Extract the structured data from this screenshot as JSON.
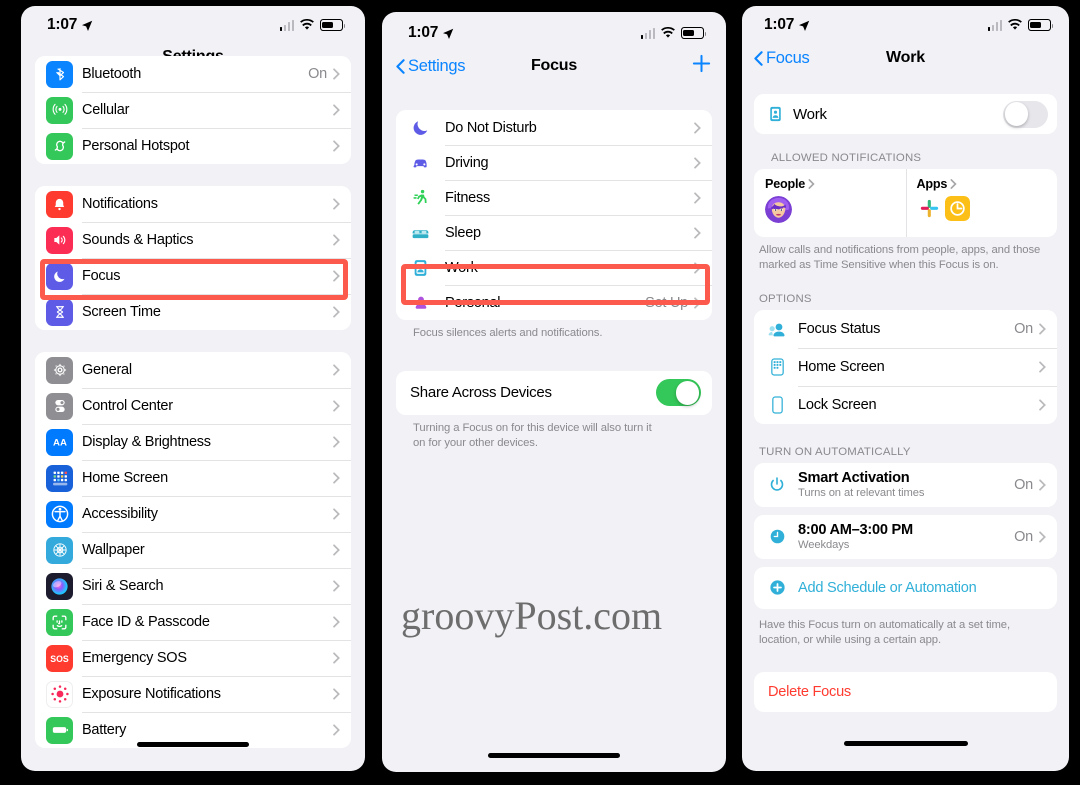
{
  "statusbar": {
    "time": "1:07",
    "location_icon": "location-arrow-icon",
    "cellular_icon": "cellular-signal-icon",
    "wifi_icon": "wifi-icon",
    "battery_icon": "battery-icon"
  },
  "watermark": {
    "text": "groovyPost.com"
  },
  "colors": {
    "accent_blue": "#0a84ff",
    "teal": "#30b0d8",
    "green": "#34c759",
    "red": "#ff3b30",
    "highlight": "#fc5a4d",
    "indigo": "#5856d6"
  },
  "panel_settings": {
    "nav": {
      "title": "Settings"
    },
    "group1": [
      {
        "label": "Bluetooth",
        "value": "On",
        "icon": "bluetooth-icon",
        "color": "#0a84ff"
      },
      {
        "label": "Cellular",
        "value": "",
        "icon": "cellular-icon",
        "color": "#34c759"
      },
      {
        "label": "Personal Hotspot",
        "value": "",
        "icon": "hotspot-icon",
        "color": "#34c759"
      }
    ],
    "group2": [
      {
        "label": "Notifications",
        "value": "",
        "icon": "notifications-bell-icon",
        "color": "#ff3b30"
      },
      {
        "label": "Sounds & Haptics",
        "value": "",
        "icon": "sounds-speaker-icon",
        "color": "#fc2d55"
      },
      {
        "label": "Focus",
        "value": "",
        "icon": "focus-moon-icon",
        "color": "#5e5ce6"
      },
      {
        "label": "Screen Time",
        "value": "",
        "icon": "screen-time-hourglass-icon",
        "color": "#5e5ce6"
      }
    ],
    "group3": [
      {
        "label": "General",
        "value": "",
        "icon": "general-gear-icon",
        "color": "#8e8e93"
      },
      {
        "label": "Control Center",
        "value": "",
        "icon": "control-center-icon",
        "color": "#8e8e93"
      },
      {
        "label": "Display & Brightness",
        "value": "",
        "icon": "display-brightness-icon",
        "color": "#007aff"
      },
      {
        "label": "Home Screen",
        "value": "",
        "icon": "home-screen-icon",
        "color": "#1961d8"
      },
      {
        "label": "Accessibility",
        "value": "",
        "icon": "accessibility-icon",
        "color": "#007aff"
      },
      {
        "label": "Wallpaper",
        "value": "",
        "icon": "wallpaper-icon",
        "color": "#34aadc"
      },
      {
        "label": "Siri & Search",
        "value": "",
        "icon": "siri-search-icon",
        "color": "#1c1c2e"
      },
      {
        "label": "Face ID & Passcode",
        "value": "",
        "icon": "face-id-icon",
        "color": "#34c759"
      },
      {
        "label": "Emergency SOS",
        "value": "",
        "icon": "emergency-sos-icon",
        "color": "#ff3b30"
      },
      {
        "label": "Exposure Notifications",
        "value": "",
        "icon": "exposure-notifications-icon",
        "color": "#ffffff"
      },
      {
        "label": "Battery",
        "value": "",
        "icon": "battery-settings-icon",
        "color": "#34c759"
      }
    ]
  },
  "panel_focus": {
    "nav": {
      "back": "Settings",
      "title": "Focus",
      "add": "+"
    },
    "items": [
      {
        "label": "Do Not Disturb",
        "value": "",
        "icon": "moon-icon",
        "color": "#5e5ce6"
      },
      {
        "label": "Driving",
        "value": "",
        "icon": "car-icon",
        "color": "#5e5ce6"
      },
      {
        "label": "Fitness",
        "value": "",
        "icon": "running-person-icon",
        "color": "#30d158"
      },
      {
        "label": "Sleep",
        "value": "",
        "icon": "bed-icon",
        "color": "#30b0c7"
      },
      {
        "label": "Work",
        "value": "",
        "icon": "work-badge-icon",
        "color": "#30b0d8"
      },
      {
        "label": "Personal",
        "value": "Set Up",
        "icon": "person-icon",
        "color": "#af52de"
      }
    ],
    "footnote": "Focus silences alerts and notifications.",
    "share": {
      "label": "Share Across Devices",
      "state": "on"
    },
    "share_footnote": "Turning a Focus on for this device will also turn it on for your other devices."
  },
  "panel_work": {
    "nav": {
      "back": "Focus",
      "title": "Work"
    },
    "master": {
      "label": "Work",
      "icon": "work-badge-icon",
      "state": "off"
    },
    "allowed": {
      "header": "ALLOWED NOTIFICATIONS",
      "people": {
        "label": "People",
        "avatar": "memoji-avatar"
      },
      "apps": {
        "label": "Apps",
        "icons": [
          "slack-app-icon",
          "shortcuts-clock-app-icon"
        ]
      },
      "footnote": "Allow calls and notifications from people, apps, and those marked as Time Sensitive when this Focus is on."
    },
    "options": {
      "header": "OPTIONS",
      "rows": [
        {
          "label": "Focus Status",
          "value": "On",
          "icon": "focus-status-icon"
        },
        {
          "label": "Home Screen",
          "value": "",
          "icon": "home-screen-phone-icon"
        },
        {
          "label": "Lock Screen",
          "value": "",
          "icon": "lock-screen-phone-icon"
        }
      ]
    },
    "automatic": {
      "header": "TURN ON AUTOMATICALLY",
      "smart": {
        "label": "Smart Activation",
        "sub": "Turns on at relevant times",
        "value": "On",
        "icon": "power-icon"
      },
      "schedule": {
        "label": "8:00 AM–3:00 PM",
        "sub": "Weekdays",
        "value": "On",
        "icon": "clock-icon"
      },
      "add": {
        "label": "Add Schedule or Automation",
        "icon": "plus-circle-icon"
      },
      "footnote": "Have this Focus turn on automatically at a set time, location, or while using a certain app."
    },
    "delete": {
      "label": "Delete Focus"
    }
  }
}
